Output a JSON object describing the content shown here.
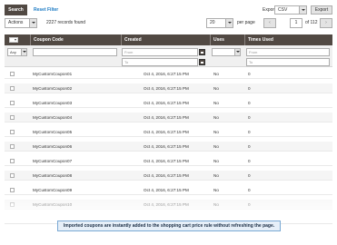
{
  "toolbar": {
    "search_label": "Search",
    "reset_label": "Reset Filter",
    "export_label": "Export to:",
    "export_format": "CSV",
    "export_button": "Export"
  },
  "massaction": {
    "actions_label": "Actions",
    "records_found": "2227 records found",
    "per_page_value": "20",
    "per_page_label": "per page",
    "prev": "‹",
    "next": "›",
    "page_value": "1",
    "page_total": "of 112"
  },
  "columns": {
    "code": "Coupon Code",
    "created": "Created",
    "used": "Uses",
    "times": "Times Used"
  },
  "filters": {
    "any": "Any",
    "from": "From",
    "to": "To"
  },
  "rows": [
    {
      "code": "MyCustomCoupon01",
      "created": "Oct 4, 2016, 6:27:15 PM",
      "used": "No",
      "times": "0"
    },
    {
      "code": "MyCustomCoupon02",
      "created": "Oct 4, 2016, 6:27:15 PM",
      "used": "No",
      "times": "0"
    },
    {
      "code": "MyCustomCoupon03",
      "created": "Oct 4, 2016, 6:27:15 PM",
      "used": "No",
      "times": "0"
    },
    {
      "code": "MyCustomCoupon04",
      "created": "Oct 4, 2016, 6:27:15 PM",
      "used": "No",
      "times": "0"
    },
    {
      "code": "MyCustomCoupon05",
      "created": "Oct 4, 2016, 6:27:15 PM",
      "used": "No",
      "times": "0"
    },
    {
      "code": "MyCustomCoupon06",
      "created": "Oct 4, 2016, 6:27:15 PM",
      "used": "No",
      "times": "0"
    },
    {
      "code": "MyCustomCoupon07",
      "created": "Oct 4, 2016, 6:27:15 PM",
      "used": "No",
      "times": "0"
    },
    {
      "code": "MyCustomCoupon08",
      "created": "Oct 4, 2016, 6:27:15 PM",
      "used": "No",
      "times": "0"
    },
    {
      "code": "MyCustomCoupon09",
      "created": "Oct 4, 2016, 6:27:15 PM",
      "used": "No",
      "times": "0"
    },
    {
      "code": "MyCustomCoupon10",
      "created": "Oct 4, 2016, 6:27:15 PM",
      "used": "No",
      "times": "0"
    },
    {
      "code": "MyCustomCoupon11",
      "created": "Oct 4, 2016, 6:27:15 PM",
      "used": "No",
      "times": "0"
    }
  ],
  "banner": "Imported coupons are instantly added to the shopping cart price rule without refreshing the page.",
  "colors": {
    "header_bg": "#514943",
    "link": "#1979c3",
    "banner_bg": "#e6eff8",
    "banner_border": "#7aa9d4"
  }
}
